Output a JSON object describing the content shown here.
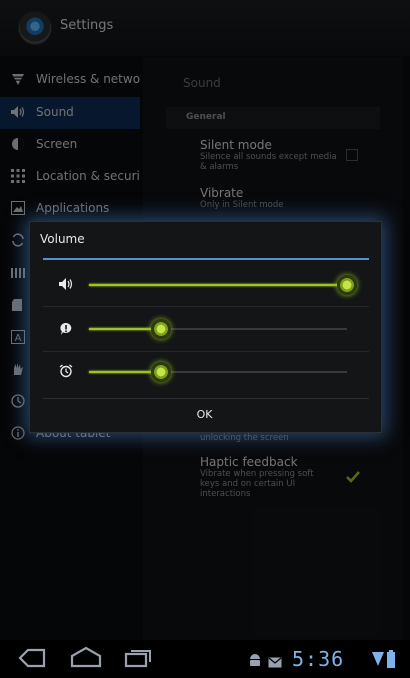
{
  "app": {
    "title": "Settings",
    "icon": "settings-icon"
  },
  "sidebar": {
    "items": [
      {
        "label": "Wireless & networks",
        "icon": "wifi-icon"
      },
      {
        "label": "Sound",
        "icon": "speaker-icon",
        "selected": true
      },
      {
        "label": "Screen",
        "icon": "brightness-icon"
      },
      {
        "label": "Location & security",
        "icon": "grid-lock-icon"
      },
      {
        "label": "Applications",
        "icon": "applications-icon"
      },
      {
        "label": "",
        "icon": "sync-icon"
      },
      {
        "label": "",
        "icon": "storage-icon"
      },
      {
        "label": "",
        "icon": "sdcard-icon"
      },
      {
        "label": "",
        "icon": "language-icon"
      },
      {
        "label": "",
        "icon": "accessibility-icon"
      },
      {
        "label": "",
        "icon": "clock-icon"
      },
      {
        "label": "About tablet",
        "icon": "info-icon"
      }
    ]
  },
  "pane": {
    "header": "Sound",
    "section": "General",
    "prefs": [
      {
        "title": "Silent mode",
        "summary": "Silence all sounds except media & alarms",
        "checked": false
      },
      {
        "title": "Vibrate",
        "summary": "Only in Silent mode"
      },
      {
        "title": "",
        "summary": "unlocking the screen"
      },
      {
        "title": "Haptic feedback",
        "summary": "Vibrate when pressing soft keys and on certain UI interactions",
        "checked": true
      }
    ]
  },
  "dialog": {
    "title": "Volume",
    "sliders": [
      {
        "name": "media",
        "icon": "speaker-icon",
        "level": 1.0
      },
      {
        "name": "notification",
        "icon": "notification-icon",
        "level": 0.28
      },
      {
        "name": "alarm",
        "icon": "alarm-icon",
        "level": 0.28
      }
    ],
    "ok_label": "OK"
  },
  "statusbar": {
    "time": "5:36",
    "accent": "#7fb2e8"
  },
  "colors": {
    "accent": "#9ec41d",
    "selection": "#0d2c55",
    "divider": "#5a8fd6"
  }
}
